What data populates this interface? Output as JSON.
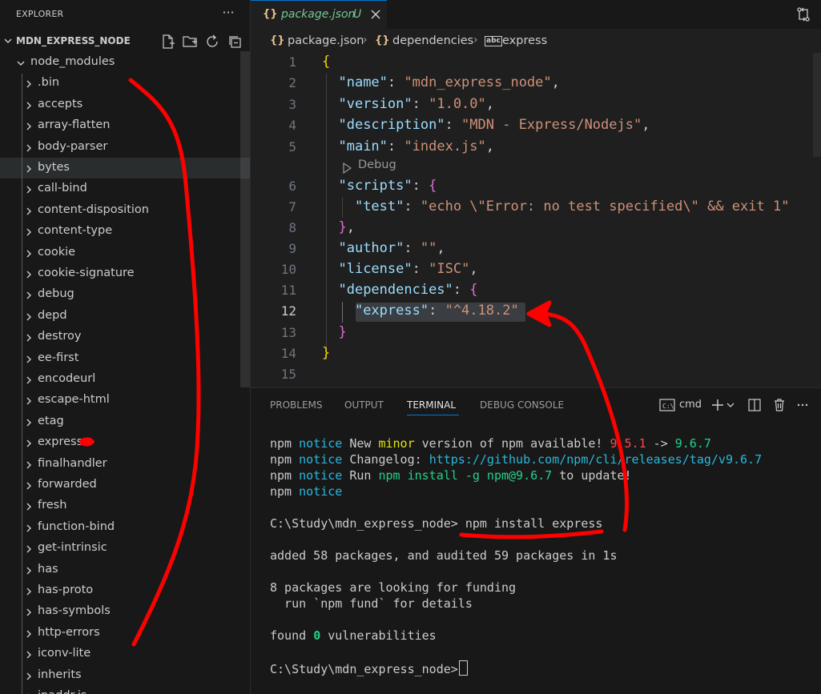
{
  "sidebar": {
    "title": "EXPLORER",
    "more_glyph": "···",
    "root": "MDN_EXPRESS_NODE",
    "node_modules": "node_modules",
    "items": [
      ".bin",
      "accepts",
      "array-flatten",
      "body-parser",
      "bytes",
      "call-bind",
      "content-disposition",
      "content-type",
      "cookie",
      "cookie-signature",
      "debug",
      "depd",
      "destroy",
      "ee-first",
      "encodeurl",
      "escape-html",
      "etag",
      "express",
      "finalhandler",
      "forwarded",
      "fresh",
      "function-bind",
      "get-intrinsic",
      "has",
      "has-proto",
      "has-symbols",
      "http-errors",
      "iconv-lite",
      "inherits",
      "ipaddr.js"
    ],
    "hovered_item": "bytes",
    "icons": [
      "new-file-icon",
      "new-folder-icon",
      "refresh-icon",
      "collapse-all-icon"
    ]
  },
  "editor": {
    "tab": {
      "icon": "{}",
      "label": "package.json",
      "badge": "U"
    },
    "breadcrumb": [
      {
        "icon": "{}",
        "label": "package.json"
      },
      {
        "icon": "{}",
        "label": "dependencies"
      },
      {
        "icon": "abc",
        "label": "express"
      }
    ],
    "codelens": "Debug",
    "line_numbers": [
      "1",
      "2",
      "3",
      "4",
      "5",
      "6",
      "7",
      "8",
      "9",
      "10",
      "11",
      "12",
      "13",
      "14",
      "15"
    ],
    "active_line": "12",
    "json": {
      "name": "mdn_express_node",
      "version": "1.0.0",
      "description": "MDN - Express/Nodejs",
      "main": "index.js",
      "scripts_test": "echo \\\"Error: no test specified\\\" && exit 1",
      "author": "",
      "license": "ISC",
      "express": "^4.18.2"
    },
    "keys": {
      "name": "\"name\"",
      "version": "\"version\"",
      "description": "\"description\"",
      "main": "\"main\"",
      "scripts": "\"scripts\"",
      "test": "\"test\"",
      "author": "\"author\"",
      "license": "\"license\"",
      "dependencies": "\"dependencies\"",
      "express": "\"express\""
    }
  },
  "panel": {
    "tabs": [
      "PROBLEMS",
      "OUTPUT",
      "TERMINAL",
      "DEBUG CONSOLE"
    ],
    "active_tab": "TERMINAL",
    "shell": "cmd",
    "terminal": {
      "npm": "npm",
      "notice": "notice",
      "l1_text": " New ",
      "l1_minor": "minor",
      "l1_rest": " version of npm available! ",
      "l1_old": "9.5.1",
      "l1_arrow": " -> ",
      "l1_new": "9.6.7",
      "l2_text": " Changelog: ",
      "l2_url": "https://github.com/npm/cli/releases/tag/v9.6.7",
      "l3_text": " Run ",
      "l3_cmd": "npm install -g npm@9.6.7",
      "l3_rest": " to update!",
      "prompt": "C:\\Study\\mdn_express_node>",
      "command": " npm install express",
      "added": "added 58 packages, and audited 59 packages in 1s",
      "funding1": "8 packages are looking for funding",
      "funding2": "  run `npm fund` for details",
      "found_a": "found ",
      "found_zero": "0",
      "found_b": " vulnerabilities"
    }
  },
  "colors": {
    "accent": "#0078d4",
    "untracked": "#73c991",
    "annotation": "#ff0000"
  }
}
